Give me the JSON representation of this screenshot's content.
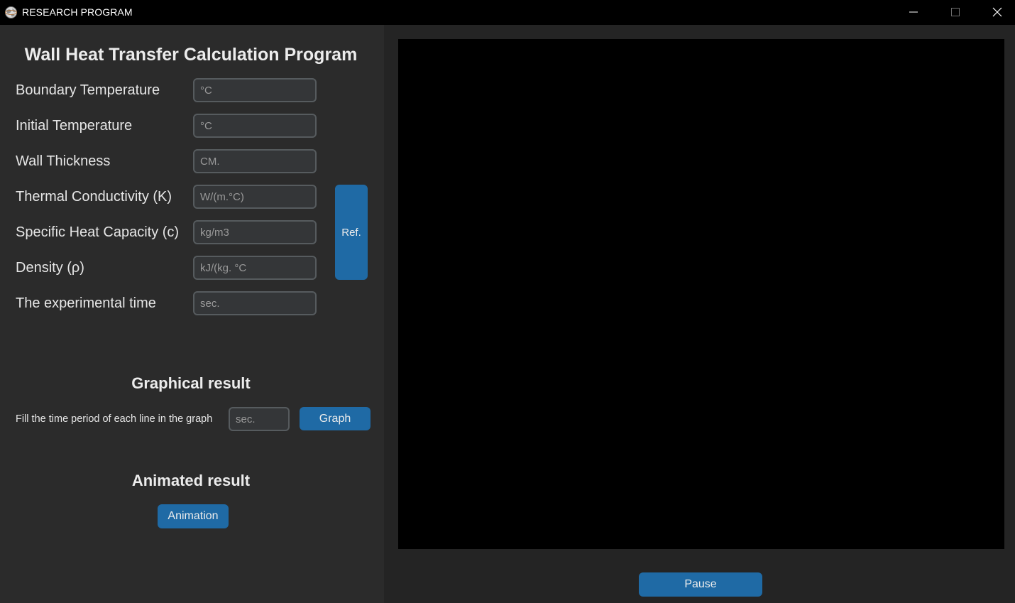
{
  "window": {
    "title": "RESEARCH PROGRAM",
    "icon": "app-globe-icon",
    "controls": {
      "minimize_icon": "minimize-icon",
      "maximize_icon": "maximize-icon",
      "close_icon": "close-icon"
    }
  },
  "form": {
    "title": "Wall Heat Transfer Calculation Program",
    "fields": [
      {
        "label": "Boundary Temperature",
        "placeholder": "°C",
        "value": ""
      },
      {
        "label": "Initial Temperature",
        "placeholder": "°C",
        "value": ""
      },
      {
        "label": "Wall Thickness",
        "placeholder": "CM.",
        "value": ""
      },
      {
        "label": "Thermal Conductivity (K)",
        "placeholder": "W/(m.°C)",
        "value": ""
      },
      {
        "label": "Specific Heat Capacity (c)",
        "placeholder": "kg/m3",
        "value": ""
      },
      {
        "label": "Density (ρ)",
        "placeholder": "kJ/(kg. °C",
        "value": ""
      },
      {
        "label": "The experimental time",
        "placeholder": "sec.",
        "value": ""
      }
    ],
    "ref_button": "Ref."
  },
  "graphical": {
    "heading": "Graphical result",
    "label": "Fill the time period of each line in the graph",
    "period_placeholder": "sec.",
    "period_value": "",
    "button": "Graph"
  },
  "animated": {
    "heading": "Animated result",
    "button": "Animation"
  },
  "display": {
    "pause_button": "Pause"
  },
  "colors": {
    "accent": "#1f6aa5",
    "panel": "#2b2b2b",
    "background": "#242424",
    "canvas": "#000000",
    "titlebar": "#000000"
  }
}
